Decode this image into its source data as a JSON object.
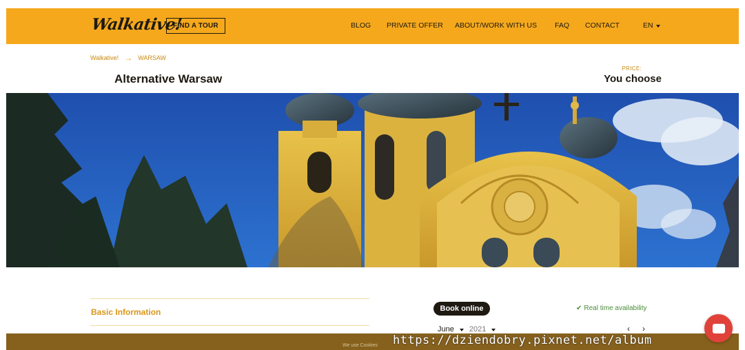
{
  "header": {
    "logo_text": "Walkative!",
    "find_tour_label": "FIND A TOUR",
    "menu": [
      {
        "label": "BLOG"
      },
      {
        "label": "PRIVATE OFFER"
      },
      {
        "label": "ABOUT/WORK WITH US"
      },
      {
        "label": "FAQ"
      },
      {
        "label": "CONTACT"
      }
    ],
    "language": "EN"
  },
  "breadcrumb": {
    "home": "Walkative!",
    "separator": "→",
    "current": "WARSAW"
  },
  "tour": {
    "title": "Alternative Warsaw",
    "price_label": "PRICE:",
    "price_value": "You choose"
  },
  "hero": {
    "icon": "orthodox-church-photo"
  },
  "basic_info": {
    "heading": "Basic Information"
  },
  "booking": {
    "button_label": "Book online",
    "availability_check": "✔",
    "availability_text": "Real time availability",
    "month": "June",
    "year": "2021",
    "prev_arrow": "‹",
    "next_arrow": "›"
  },
  "cookie": {
    "text": "We use Cookies"
  },
  "watermark": {
    "text": "https://dziendobry.pixnet.net/album"
  },
  "colors": {
    "brand_yellow": "#f5a81c",
    "dark": "#1e1a12",
    "accent_orange": "#d9961a",
    "available_green": "#4b8c3a",
    "chat_red": "#e0423a",
    "cookie_bar": "#7d550c"
  }
}
